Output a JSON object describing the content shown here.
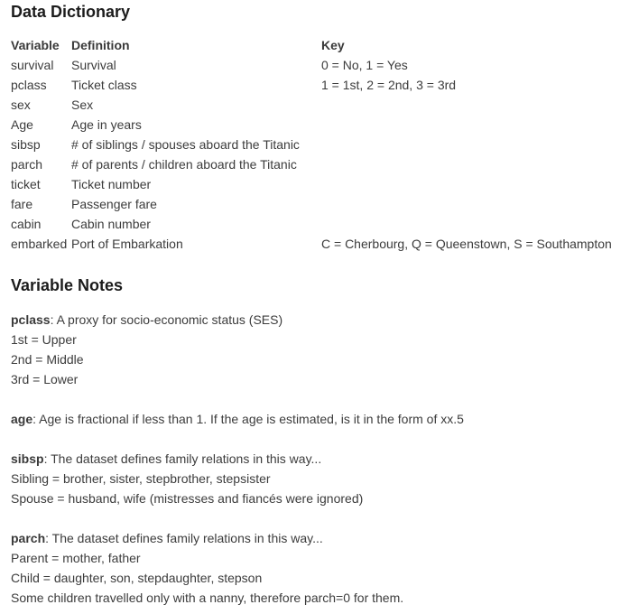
{
  "data_dictionary": {
    "title": "Data Dictionary",
    "headers": {
      "variable": "Variable",
      "definition": "Definition",
      "key": "Key"
    },
    "rows": [
      {
        "variable": "survival",
        "definition": "Survival",
        "key": "0 = No, 1 = Yes"
      },
      {
        "variable": "pclass",
        "definition": "Ticket class",
        "key": "1 = 1st, 2 = 2nd, 3 = 3rd"
      },
      {
        "variable": "sex",
        "definition": "Sex",
        "key": ""
      },
      {
        "variable": "Age",
        "definition": "Age in years",
        "key": ""
      },
      {
        "variable": "sibsp",
        "definition": "# of siblings / spouses aboard the Titanic",
        "key": ""
      },
      {
        "variable": "parch",
        "definition": "# of parents / children aboard the Titanic",
        "key": ""
      },
      {
        "variable": "ticket",
        "definition": "Ticket number",
        "key": ""
      },
      {
        "variable": "fare",
        "definition": "Passenger fare",
        "key": ""
      },
      {
        "variable": "cabin",
        "definition": "Cabin number",
        "key": ""
      },
      {
        "variable": "embarked",
        "definition": "Port of Embarkation",
        "key": "C = Cherbourg, Q = Queenstown, S = Southampton"
      }
    ]
  },
  "variable_notes": {
    "title": "Variable Notes",
    "pclass": {
      "term": "pclass",
      "text": ": A proxy for socio-economic status (SES)",
      "lines": [
        "1st = Upper",
        "2nd = Middle",
        "3rd = Lower"
      ]
    },
    "age": {
      "term": "age",
      "text": ": Age is fractional if less than 1. If the age is estimated, is it in the form of xx.5"
    },
    "sibsp": {
      "term": "sibsp",
      "text": ": The dataset defines family relations in this way...",
      "lines": [
        "Sibling = brother, sister, stepbrother, stepsister",
        "Spouse = husband, wife (mistresses and fiancés were ignored)"
      ]
    },
    "parch": {
      "term": "parch",
      "text": ": The dataset defines family relations in this way...",
      "lines": [
        "Parent = mother, father",
        "Child = daughter, son, stepdaughter, stepson",
        "Some children travelled only with a nanny, therefore parch=0 for them."
      ]
    }
  }
}
